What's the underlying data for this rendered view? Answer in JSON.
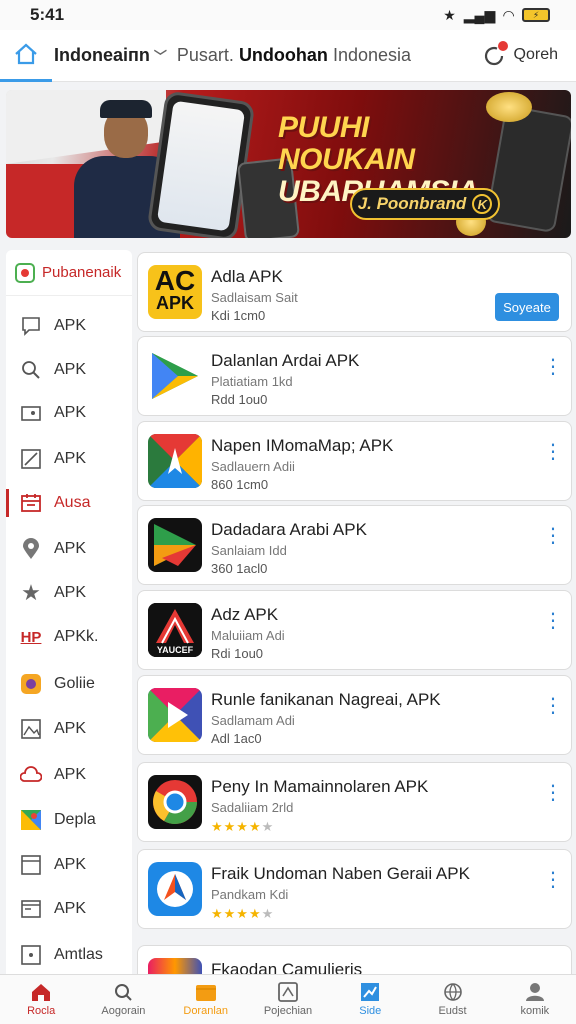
{
  "status": {
    "time": "5:41"
  },
  "header": {
    "region": "Indoneaiпn",
    "title_prefix": "Pusart.",
    "title_bold": "Undoohan",
    "title_suffix": "Indonesia",
    "user_link": "Qoreh"
  },
  "banner": {
    "title_line1": "PUUHI NOUKAIN",
    "title_line2": "UBARUAMSIA",
    "pill": "J. Poonbrand",
    "pill_badge": "K"
  },
  "sidebar": {
    "header": "Pubanenaik",
    "items": [
      {
        "label": "APK",
        "icon": "chat-icon"
      },
      {
        "label": "APK",
        "icon": "search-icon"
      },
      {
        "label": "APK",
        "icon": "folder-icon"
      },
      {
        "label": "APK",
        "icon": "edit-icon"
      },
      {
        "label": "Ausa",
        "icon": "calendar-icon",
        "active": true
      },
      {
        "label": "APK",
        "icon": "location-icon"
      },
      {
        "label": "APK",
        "icon": "star-icon"
      },
      {
        "label": "APKk.",
        "icon": "hp-logo-icon"
      },
      {
        "label": "Goliie",
        "icon": "app-badge-icon"
      },
      {
        "label": "APK",
        "icon": "image-icon"
      },
      {
        "label": "APK",
        "icon": "cloud-icon"
      },
      {
        "label": "Depla",
        "icon": "maps-icon"
      },
      {
        "label": "APK",
        "icon": "box-icon"
      },
      {
        "label": "APK",
        "icon": "window-icon"
      },
      {
        "label": "Amtlas",
        "icon": "square-icon"
      }
    ]
  },
  "apps": [
    {
      "name": "Adla APK",
      "subtitle": "Sadlaisam Sait",
      "meta": "Kdi 1cm0",
      "action": "Soyeate",
      "icon": "acapk-icon"
    },
    {
      "name": "Dalanlan Ardai APK",
      "subtitle": "Platiatiam 1kd",
      "meta": "Rdd 1ou0",
      "icon": "play-icon"
    },
    {
      "name": "Napen IMomaMap; APK",
      "subtitle": "Sadlauern Adii",
      "meta": "860 1cm0",
      "icon": "arrow-colorful-icon"
    },
    {
      "name": "Dadadara Arabi APK",
      "subtitle": "Sanlaiam Idd",
      "meta": "360 1acl0",
      "icon": "play-dark-icon"
    },
    {
      "name": "Adz APK",
      "subtitle": "Maluiiam Adi",
      "meta": "Rdi 1ou0",
      "icon": "a-logo-icon",
      "icon_caption": "YAUCEF"
    },
    {
      "name": "Runle fanikanan Nagreai, APK",
      "subtitle": "Sadlamam Adi",
      "meta": "Adl 1ac0",
      "icon": "play-gradient-icon"
    },
    {
      "name": "Peny In Mamainnolaren APK",
      "subtitle": "Sadaliiam 2rld",
      "rating": 4,
      "icon": "chrome-like-icon"
    },
    {
      "name": "Fraik Undoman Naben Geraii APK",
      "subtitle": "Pandkam Kdi",
      "rating": 4,
      "icon": "compass-icon"
    },
    {
      "name": "Fkaodan Camulieris",
      "subtitle": "",
      "icon": "partial-app-icon"
    }
  ],
  "bottom_nav": [
    {
      "label": "Rocla",
      "icon": "home-icon"
    },
    {
      "label": "Aogorain",
      "icon": "search-icon"
    },
    {
      "label": "Doranlan",
      "icon": "download-icon"
    },
    {
      "label": "Pojechian",
      "icon": "tablet-icon"
    },
    {
      "label": "Side",
      "icon": "chart-icon"
    },
    {
      "label": "Eudst",
      "icon": "globe-icon"
    },
    {
      "label": "komik",
      "icon": "profile-icon"
    }
  ]
}
